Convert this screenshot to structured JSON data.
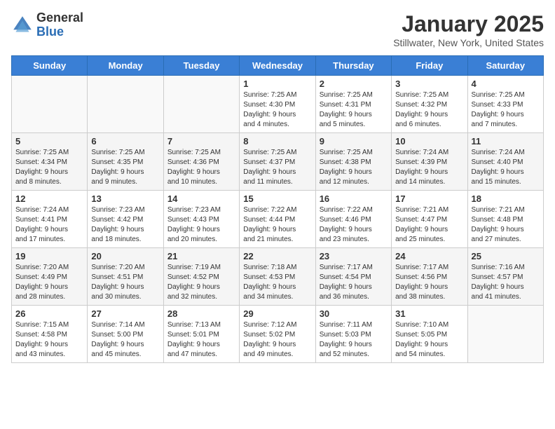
{
  "logo": {
    "general": "General",
    "blue": "Blue"
  },
  "title": "January 2025",
  "location": "Stillwater, New York, United States",
  "days_of_week": [
    "Sunday",
    "Monday",
    "Tuesday",
    "Wednesday",
    "Thursday",
    "Friday",
    "Saturday"
  ],
  "weeks": [
    [
      {
        "day": "",
        "info": ""
      },
      {
        "day": "",
        "info": ""
      },
      {
        "day": "",
        "info": ""
      },
      {
        "day": "1",
        "info": "Sunrise: 7:25 AM\nSunset: 4:30 PM\nDaylight: 9 hours\nand 4 minutes."
      },
      {
        "day": "2",
        "info": "Sunrise: 7:25 AM\nSunset: 4:31 PM\nDaylight: 9 hours\nand 5 minutes."
      },
      {
        "day": "3",
        "info": "Sunrise: 7:25 AM\nSunset: 4:32 PM\nDaylight: 9 hours\nand 6 minutes."
      },
      {
        "day": "4",
        "info": "Sunrise: 7:25 AM\nSunset: 4:33 PM\nDaylight: 9 hours\nand 7 minutes."
      }
    ],
    [
      {
        "day": "5",
        "info": "Sunrise: 7:25 AM\nSunset: 4:34 PM\nDaylight: 9 hours\nand 8 minutes."
      },
      {
        "day": "6",
        "info": "Sunrise: 7:25 AM\nSunset: 4:35 PM\nDaylight: 9 hours\nand 9 minutes."
      },
      {
        "day": "7",
        "info": "Sunrise: 7:25 AM\nSunset: 4:36 PM\nDaylight: 9 hours\nand 10 minutes."
      },
      {
        "day": "8",
        "info": "Sunrise: 7:25 AM\nSunset: 4:37 PM\nDaylight: 9 hours\nand 11 minutes."
      },
      {
        "day": "9",
        "info": "Sunrise: 7:25 AM\nSunset: 4:38 PM\nDaylight: 9 hours\nand 12 minutes."
      },
      {
        "day": "10",
        "info": "Sunrise: 7:24 AM\nSunset: 4:39 PM\nDaylight: 9 hours\nand 14 minutes."
      },
      {
        "day": "11",
        "info": "Sunrise: 7:24 AM\nSunset: 4:40 PM\nDaylight: 9 hours\nand 15 minutes."
      }
    ],
    [
      {
        "day": "12",
        "info": "Sunrise: 7:24 AM\nSunset: 4:41 PM\nDaylight: 9 hours\nand 17 minutes."
      },
      {
        "day": "13",
        "info": "Sunrise: 7:23 AM\nSunset: 4:42 PM\nDaylight: 9 hours\nand 18 minutes."
      },
      {
        "day": "14",
        "info": "Sunrise: 7:23 AM\nSunset: 4:43 PM\nDaylight: 9 hours\nand 20 minutes."
      },
      {
        "day": "15",
        "info": "Sunrise: 7:22 AM\nSunset: 4:44 PM\nDaylight: 9 hours\nand 21 minutes."
      },
      {
        "day": "16",
        "info": "Sunrise: 7:22 AM\nSunset: 4:46 PM\nDaylight: 9 hours\nand 23 minutes."
      },
      {
        "day": "17",
        "info": "Sunrise: 7:21 AM\nSunset: 4:47 PM\nDaylight: 9 hours\nand 25 minutes."
      },
      {
        "day": "18",
        "info": "Sunrise: 7:21 AM\nSunset: 4:48 PM\nDaylight: 9 hours\nand 27 minutes."
      }
    ],
    [
      {
        "day": "19",
        "info": "Sunrise: 7:20 AM\nSunset: 4:49 PM\nDaylight: 9 hours\nand 28 minutes."
      },
      {
        "day": "20",
        "info": "Sunrise: 7:20 AM\nSunset: 4:51 PM\nDaylight: 9 hours\nand 30 minutes."
      },
      {
        "day": "21",
        "info": "Sunrise: 7:19 AM\nSunset: 4:52 PM\nDaylight: 9 hours\nand 32 minutes."
      },
      {
        "day": "22",
        "info": "Sunrise: 7:18 AM\nSunset: 4:53 PM\nDaylight: 9 hours\nand 34 minutes."
      },
      {
        "day": "23",
        "info": "Sunrise: 7:17 AM\nSunset: 4:54 PM\nDaylight: 9 hours\nand 36 minutes."
      },
      {
        "day": "24",
        "info": "Sunrise: 7:17 AM\nSunset: 4:56 PM\nDaylight: 9 hours\nand 38 minutes."
      },
      {
        "day": "25",
        "info": "Sunrise: 7:16 AM\nSunset: 4:57 PM\nDaylight: 9 hours\nand 41 minutes."
      }
    ],
    [
      {
        "day": "26",
        "info": "Sunrise: 7:15 AM\nSunset: 4:58 PM\nDaylight: 9 hours\nand 43 minutes."
      },
      {
        "day": "27",
        "info": "Sunrise: 7:14 AM\nSunset: 5:00 PM\nDaylight: 9 hours\nand 45 minutes."
      },
      {
        "day": "28",
        "info": "Sunrise: 7:13 AM\nSunset: 5:01 PM\nDaylight: 9 hours\nand 47 minutes."
      },
      {
        "day": "29",
        "info": "Sunrise: 7:12 AM\nSunset: 5:02 PM\nDaylight: 9 hours\nand 49 minutes."
      },
      {
        "day": "30",
        "info": "Sunrise: 7:11 AM\nSunset: 5:03 PM\nDaylight: 9 hours\nand 52 minutes."
      },
      {
        "day": "31",
        "info": "Sunrise: 7:10 AM\nSunset: 5:05 PM\nDaylight: 9 hours\nand 54 minutes."
      },
      {
        "day": "",
        "info": ""
      }
    ]
  ]
}
